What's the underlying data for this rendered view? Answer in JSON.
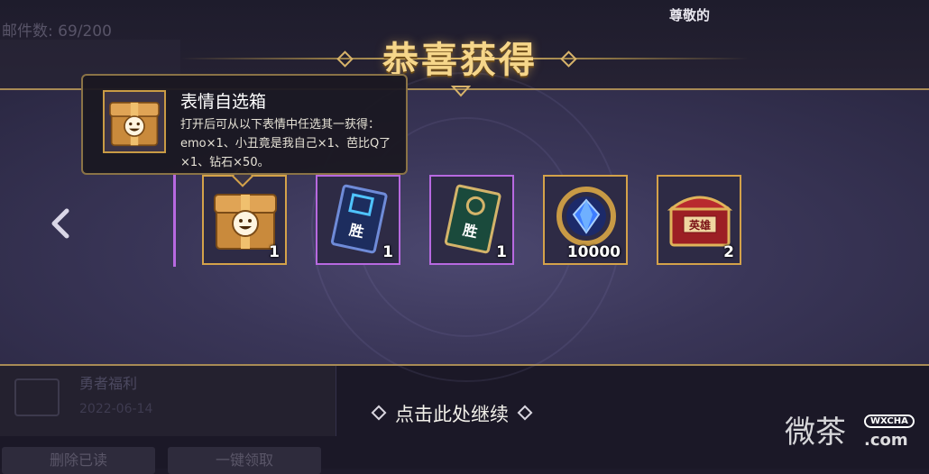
{
  "background": {
    "mail_count": "邮件数: 69/200",
    "respect": "尊敬的",
    "mail_item_title": "勇者福利",
    "mail_item_date": "2022-06-14",
    "delete_read_label": "删除已读",
    "claim_all_label": "一键领取"
  },
  "dialog": {
    "title": "恭喜获得",
    "continue_label": "点击此处继续"
  },
  "tooltip": {
    "name": "表情自选箱",
    "desc": "打开后可从以下表情中任选其一获得：emo×1、小丑竟是我自己×1、芭比Q了×1、钻石×50。"
  },
  "items": [
    {
      "name": "表情自选箱",
      "qty": "1",
      "border": "gold",
      "icon": "emote-chest-icon"
    },
    {
      "name": "胜利卡（蓝）",
      "qty": "1",
      "border": "purple",
      "icon": "victory-card-blue-icon",
      "label": "胜"
    },
    {
      "name": "胜利卡（绿）",
      "qty": "1",
      "border": "purple",
      "icon": "victory-card-green-icon",
      "label": "胜"
    },
    {
      "name": "钻石",
      "qty": "10000",
      "border": "gold",
      "icon": "diamond-icon"
    },
    {
      "name": "英雄宝箱",
      "qty": "2",
      "border": "gold",
      "icon": "hero-chest-icon",
      "label": "英雄"
    }
  ],
  "watermark": {
    "text": "微茶",
    "badge": "WXCHA",
    "domain": ".com"
  },
  "colors": {
    "gold": "#d4a24a",
    "purple": "#b769e0",
    "title": "#f6d68a"
  }
}
